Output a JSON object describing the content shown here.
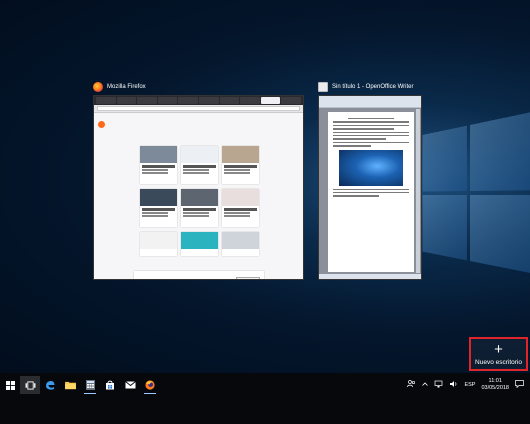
{
  "windows": [
    {
      "title": "Mozilla Firefox",
      "icon": "firefox-icon"
    },
    {
      "title": "Sin título 1 - OpenOffice Writer",
      "icon": "openoffice-writer-icon"
    }
  ],
  "new_desktop": {
    "label": "Nuevo escritorio",
    "icon": "plus-icon"
  },
  "taskbar": {
    "items": [
      "windows-start-icon",
      "task-view-icon",
      "edge-icon",
      "file-explorer-icon",
      "calculator-icon",
      "store-icon",
      "mail-icon",
      "firefox-icon"
    ],
    "language": "ESP",
    "time": "11:01",
    "date": "03/05/2018"
  },
  "colors": {
    "highlight": "#e0252a",
    "desktop_blue": "#0e3a66",
    "taskbar": "#06080c"
  }
}
